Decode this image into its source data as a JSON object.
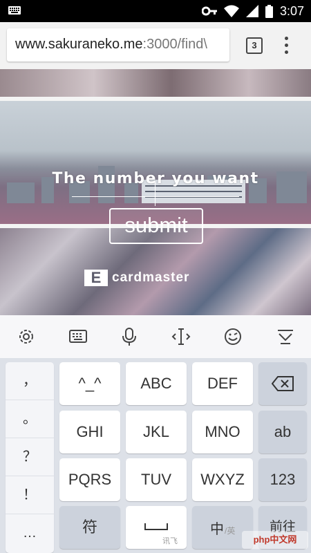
{
  "status_bar": {
    "time": "3:07",
    "icons": [
      "keyboard-icon",
      "key-icon",
      "wifi-icon",
      "signal-icon",
      "battery-icon"
    ]
  },
  "browser": {
    "url_host": "www.sakuraneko.me",
    "url_path": ":3000/find\\",
    "tab_count": "3"
  },
  "page": {
    "title": "The number you want",
    "submit_label": "submit",
    "brand_mark": "E",
    "brand_name": "cardmaster"
  },
  "keyboard": {
    "toolbar_icons": [
      "settings-icon",
      "keyboard-layout-icon",
      "microphone-icon",
      "cursor-icon",
      "emoji-icon",
      "hide-keyboard-icon"
    ],
    "side_keys": [
      "，",
      "。",
      "？",
      "！",
      "…"
    ],
    "rows": [
      [
        "^_^",
        "ABC",
        "DEF"
      ],
      [
        "GHI",
        "JKL",
        "MNO"
      ],
      [
        "PQRS",
        "TUV",
        "WXYZ"
      ]
    ],
    "right_keys": [
      "ab",
      "123"
    ],
    "bottom": {
      "symbol": "符",
      "space_sub": "讯飞",
      "lang_main": "中",
      "lang_sub": "/英",
      "go": "前往"
    }
  },
  "watermark": "php中文网"
}
